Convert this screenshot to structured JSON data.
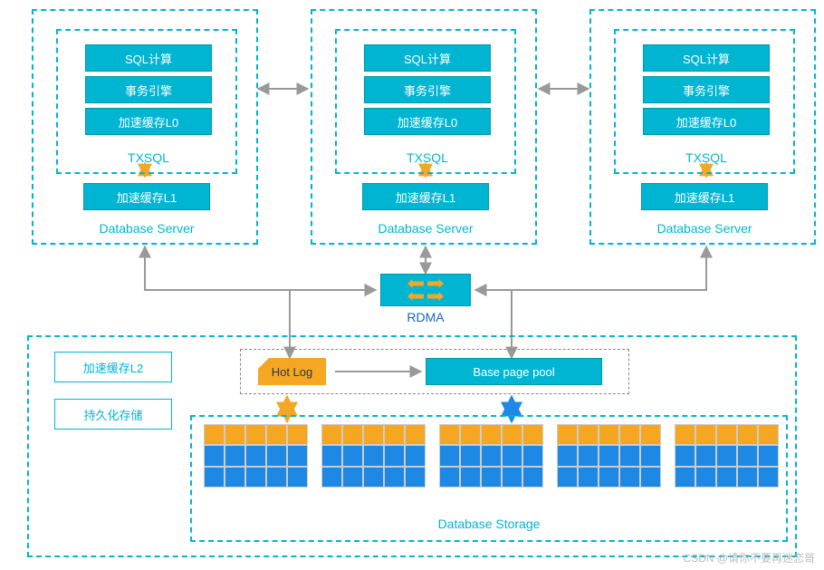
{
  "db_servers": [
    {
      "boxes": [
        "SQL计算",
        "事务引擎",
        "加速缓存L0"
      ],
      "inner_label": "TXSQL",
      "l1": "加速缓存L1",
      "caption": "Database Server"
    },
    {
      "boxes": [
        "SQL计算",
        "事务引擎",
        "加速缓存L0"
      ],
      "inner_label": "TXSQL",
      "l1": "加速缓存L1",
      "caption": "Database Server"
    },
    {
      "boxes": [
        "SQL计算",
        "事务引擎",
        "加速缓存L0"
      ],
      "inner_label": "TXSQL",
      "l1": "加速缓存L1",
      "caption": "Database Server"
    }
  ],
  "rdma": {
    "label": "RDMA"
  },
  "storage": {
    "side": {
      "l2": "加速缓存L2",
      "persist": "持久化存储"
    },
    "pool": {
      "hot": "Hot Log",
      "base": "Base page pool"
    },
    "caption": "Database Storage"
  },
  "watermark": "CSDN @请你不要再迷恋哥",
  "chart_data": {
    "type": "diagram",
    "nodes": [
      {
        "id": "server1",
        "label": "Database Server",
        "children": [
          "SQL计算",
          "事务引擎",
          "加速缓存L0",
          "TXSQL",
          "加速缓存L1"
        ]
      },
      {
        "id": "server2",
        "label": "Database Server",
        "children": [
          "SQL计算",
          "事务引擎",
          "加速缓存L0",
          "TXSQL",
          "加速缓存L1"
        ]
      },
      {
        "id": "server3",
        "label": "Database Server",
        "children": [
          "SQL计算",
          "事务引擎",
          "加速缓存L0",
          "TXSQL",
          "加速缓存L1"
        ]
      },
      {
        "id": "rdma",
        "label": "RDMA"
      },
      {
        "id": "storage",
        "label": "Database Storage",
        "children": [
          "加速缓存L2",
          "持久化存储",
          "Hot Log",
          "Base page pool",
          "storage-blocks x5"
        ]
      }
    ],
    "edges": [
      {
        "from": "server1",
        "to": "server2",
        "style": "bidirectional"
      },
      {
        "from": "server2",
        "to": "server3",
        "style": "bidirectional"
      },
      {
        "from": "server1",
        "to": "rdma",
        "style": "bidirectional"
      },
      {
        "from": "server2",
        "to": "rdma",
        "style": "bidirectional"
      },
      {
        "from": "server3",
        "to": "rdma",
        "style": "bidirectional"
      },
      {
        "from": "rdma",
        "to": "Hot Log",
        "style": "bidirectional"
      },
      {
        "from": "rdma",
        "to": "Base page pool",
        "style": "bidirectional"
      },
      {
        "from": "Hot Log",
        "to": "Base page pool",
        "style": "directed"
      },
      {
        "from": "Hot Log",
        "to": "storage-blocks",
        "style": "bidirectional",
        "color": "#F5A623"
      },
      {
        "from": "Base page pool",
        "to": "storage-blocks",
        "style": "bidirectional",
        "color": "#1E88E5"
      }
    ]
  }
}
